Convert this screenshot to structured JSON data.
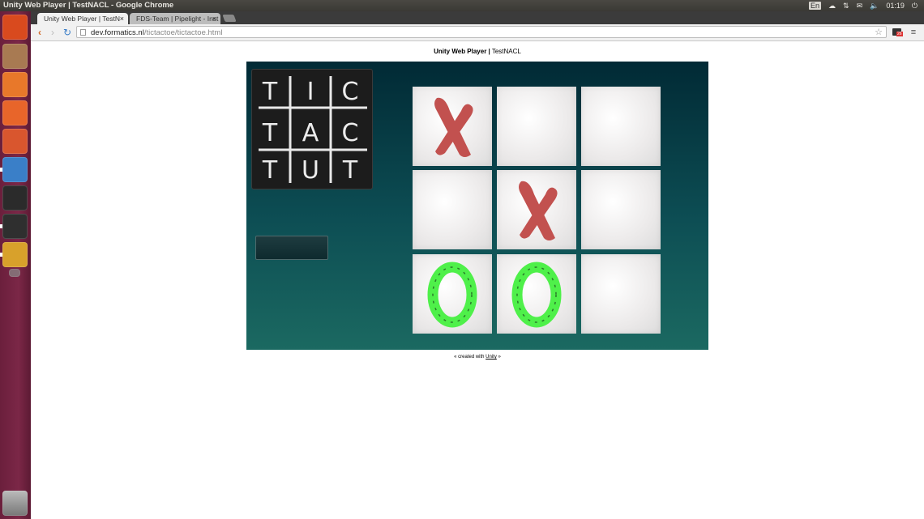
{
  "system_bar": {
    "title": "Unity Web Player | TestNACL - Google Chrome",
    "keyboard": "En",
    "clock": "01:19"
  },
  "launcher": {
    "items": [
      {
        "name": "ubuntu-dash-icon",
        "color": "#d94a1e"
      },
      {
        "name": "files-icon",
        "color": "#a87a52"
      },
      {
        "name": "firefox-icon",
        "color": "#e8782a"
      },
      {
        "name": "software-center-icon",
        "color": "#e8652a"
      },
      {
        "name": "system-settings-icon",
        "color": "#d9562e"
      },
      {
        "name": "chromium-icon",
        "color": "#3a7fc8"
      },
      {
        "name": "terminal-icon",
        "color": "#2b2b2b"
      },
      {
        "name": "system-monitor-icon",
        "color": "#2f2f2f"
      },
      {
        "name": "chrome-icon",
        "color": "#d8a12b"
      },
      {
        "name": "workspace-icon",
        "color": "#8a8a8a"
      },
      {
        "name": "trash-icon",
        "color": "#888888"
      }
    ]
  },
  "browser": {
    "tabs": [
      {
        "label": "Unity Web Player | TestN",
        "active": true
      },
      {
        "label": "FDS-Team | Pipelight - Inst",
        "active": false
      }
    ],
    "url_host": "dev.formatics.nl",
    "url_path": "/tictactoe/tictactoe.html",
    "extension_badge": "26"
  },
  "page": {
    "heading_bold": "Unity Web Player |",
    "heading_rest": " TestNACL",
    "footer_before": "« created with ",
    "footer_link": "Unity",
    "footer_after": " »"
  },
  "game": {
    "logo_rows": [
      [
        "T",
        "I",
        "C"
      ],
      [
        "T",
        "A",
        "C"
      ],
      [
        "T",
        "U",
        "T"
      ]
    ],
    "board": [
      "X",
      "",
      "",
      "",
      "X",
      "",
      "O",
      "O",
      ""
    ],
    "colors": {
      "x": "#c2514f",
      "o": "#4ff04a",
      "background": "#0d4e54"
    }
  }
}
